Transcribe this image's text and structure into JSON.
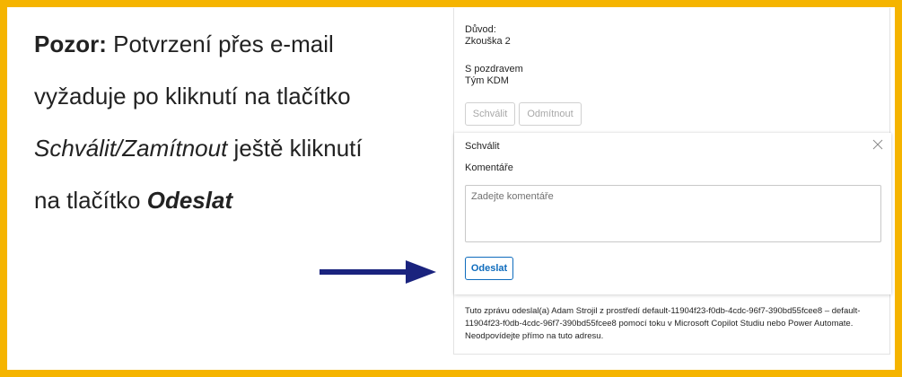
{
  "callout": {
    "line1_bold": "Pozor:",
    "line1_rest": " Potvrzení přes e-mail",
    "line2": "vyžaduje po kliknutí na tlačítko",
    "line3_italic": "Schválit/Zamítnout",
    "line3_rest": " ještě kliknutí",
    "line4_rest": "na tlačítko ",
    "line4_bold": "Odeslat"
  },
  "email": {
    "reason_label": "Důvod:",
    "reason_value": "Zkouška 2",
    "greeting": "S pozdravem",
    "team": "Tým KDM",
    "approve_button": "Schválit",
    "reject_button": "Odmítnout",
    "card": {
      "title": "Schválit",
      "comments_label": "Komentáře",
      "comments_placeholder": "Zadejte komentáře",
      "submit_button": "Odeslat"
    },
    "footer_text": "Tuto zprávu odeslal(a) Adam Strojil z prostředí default-11904f23-f0db-4cdc-96f7-390bd55fcee8 – default-11904f23-f0db-4cdc-96f7-390bd55fcee8 pomocí toku v Microsoft Copilot Studiu nebo Power Automate. Neodpovídejte přímo na tuto adresu."
  },
  "colors": {
    "frame": "#F5B400",
    "arrow": "#1a237e",
    "accent": "#0f6cbd"
  },
  "icons": {
    "close": "close-icon",
    "arrow": "arrow-right-icon"
  }
}
